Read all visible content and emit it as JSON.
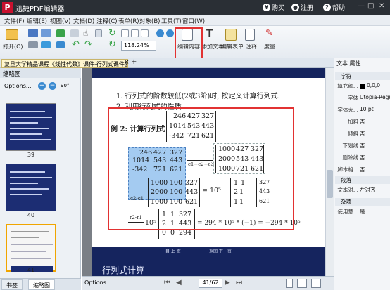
{
  "app": {
    "title": "迅捷PDF编辑器",
    "logo": "P",
    "buy": "购买",
    "register": "注册",
    "help": "帮助"
  },
  "menu": [
    "文件(F)",
    "编辑(E)",
    "视图(V)",
    "文档(D)",
    "注释(C)",
    "表单(R)",
    "对象(B)",
    "工具(T)",
    "窗口(W)"
  ],
  "toolbar": {
    "open": "打开(O)...",
    "zoom": "118.24%",
    "edit_content": "编辑内容",
    "add_text": "添加文本",
    "edit_form": "编辑表单",
    "comment": "注释",
    "measure": "度量"
  },
  "tab": {
    "label": "复旦大学精品课程《线性代数》课件-行列式课件复习.*",
    "close": "×",
    "add": "+"
  },
  "left_panel": {
    "header": "缩略图",
    "options": "Options...",
    "rotate": "90°",
    "thumbs": [
      "39",
      "40",
      "41"
    ],
    "bottom_tabs": [
      "书签",
      "缩略图"
    ]
  },
  "page": {
    "line1": "1. 行列式的阶数较低(2或3阶)时, 按定义计算行列式.",
    "line2": "2. 利用行列式的性质",
    "example": "例 2: 计算行列式",
    "m1": [
      [
        "246",
        "427",
        "327"
      ],
      [
        "1014",
        "543",
        "443"
      ],
      [
        "-342",
        "721",
        "621"
      ]
    ],
    "m_sel": [
      [
        "246",
        "427",
        "327"
      ],
      [
        "1014",
        "543",
        "443"
      ],
      [
        "-342",
        "721",
        "621"
      ]
    ],
    "m_colop": "c1+c2+c3",
    "m2": [
      [
        "1000",
        "427",
        "327"
      ],
      [
        "2000",
        "543",
        "443"
      ],
      [
        "1000",
        "721",
        "621"
      ]
    ],
    "m3": [
      [
        "1000",
        "100",
        "327"
      ],
      [
        "2000",
        "100",
        "443"
      ],
      [
        "1000",
        "100",
        "621"
      ]
    ],
    "m3_op": "c2-c1",
    "eq_mid": "= 10⁵",
    "m4": [
      [
        "1",
        "1",
        "327"
      ],
      [
        "2",
        "1",
        "443"
      ],
      [
        "1",
        "1",
        "621"
      ]
    ],
    "bottom_left_op": "r2-r1",
    "bottom_left_scale": "10⁵",
    "m5": [
      [
        "1",
        "1",
        "327"
      ],
      [
        "2",
        "1",
        "443"
      ],
      [
        "0",
        "0",
        "294"
      ]
    ],
    "result": "= 294 * 10⁵ * (−1) = −294 * 10⁵",
    "footer_l": "目 上 页",
    "footer_r": "返回  下一页",
    "next_title": "行列式计算"
  },
  "status": {
    "options": "Options...",
    "page": "41/62"
  },
  "right_panel": {
    "header": "文本 属性",
    "sections": [
      "字符",
      "段落",
      "杂项"
    ],
    "props": [
      {
        "k": "填充颜...",
        "v": "0,0,0"
      },
      {
        "k": "字体",
        "v": "Utopia-Regu..."
      },
      {
        "k": "字体大...",
        "v": "10 pt"
      },
      {
        "k": "加粗",
        "v": "否"
      },
      {
        "k": "倾斜",
        "v": "否"
      },
      {
        "k": "下划线",
        "v": "否"
      },
      {
        "k": "删除线",
        "v": "否"
      },
      {
        "k": "脚本格...",
        "v": "否"
      }
    ],
    "para": [
      {
        "k": "文本对...",
        "v": "左对齐"
      }
    ],
    "misc": [
      {
        "k": "使用意...",
        "v": "是"
      }
    ]
  },
  "colors": {
    "title_bg": "#2a2f35",
    "highlight": "#e23232",
    "selection": "#5aa0e6",
    "slide_bg": "#15245e"
  }
}
